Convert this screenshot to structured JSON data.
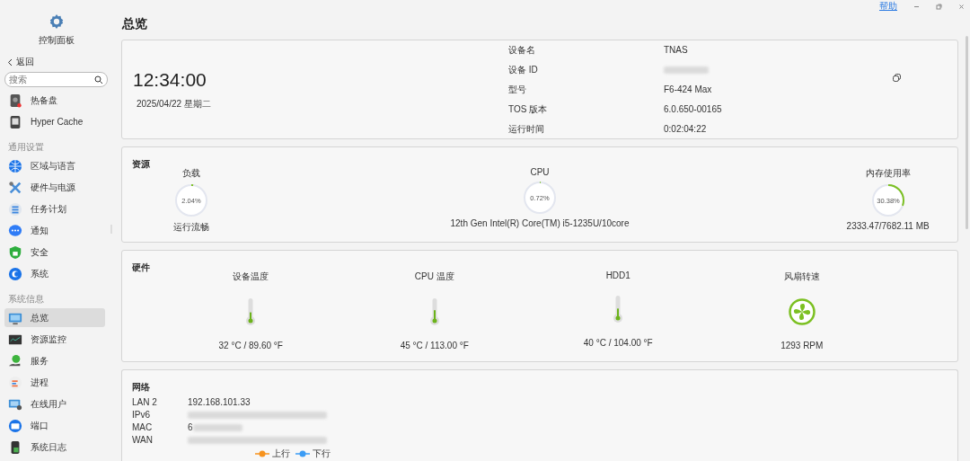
{
  "sidebar": {
    "title": "控制面板",
    "back": "返回",
    "search": {
      "placeholder": "搜索"
    },
    "groups": [
      {
        "items": [
          {
            "label": "热备盘",
            "selected": false
          },
          {
            "label": "Hyper Cache",
            "selected": false
          }
        ]
      },
      {
        "title": "通用设置",
        "items": [
          {
            "label": "区域与语言",
            "selected": false
          },
          {
            "label": "硬件与电源",
            "selected": false
          },
          {
            "label": "任务计划",
            "selected": false
          },
          {
            "label": "通知",
            "selected": false
          },
          {
            "label": "安全",
            "selected": false
          },
          {
            "label": "系统",
            "selected": false
          }
        ]
      },
      {
        "title": "系统信息",
        "items": [
          {
            "label": "总览",
            "selected": true
          },
          {
            "label": "资源监控",
            "selected": false
          },
          {
            "label": "服务",
            "selected": false
          },
          {
            "label": "进程",
            "selected": false
          },
          {
            "label": "在线用户",
            "selected": false
          },
          {
            "label": "端口",
            "selected": false
          },
          {
            "label": "系统日志",
            "selected": false
          }
        ]
      }
    ]
  },
  "window": {
    "help": "帮助"
  },
  "page_title": "总览",
  "overview": {
    "time": "12:34:00",
    "date": "2025/04/22 星期二",
    "fields": [
      {
        "label": "设备名",
        "value": "TNAS",
        "blurred": false
      },
      {
        "label": "设备 ID",
        "blurred": true
      },
      {
        "label": "型号",
        "value": "F6-424 Max",
        "blurred": false
      },
      {
        "label": "TOS 版本",
        "value": "6.0.650-00165",
        "blurred": false
      },
      {
        "label": "运行时间",
        "value": "0:02:04:22",
        "blurred": false
      }
    ]
  },
  "resources": {
    "title": "资源",
    "gauges": [
      {
        "label": "负载",
        "reading": "2.04%",
        "level": 0.0204,
        "caption": "运行流畅"
      },
      {
        "label": "CPU",
        "reading": "0.72%",
        "level": 0.0072,
        "caption": "12th Gen Intel(R) Core(TM) i5-1235U/10core"
      },
      {
        "label": "内存使用率",
        "reading": "30.38%",
        "level": 0.3038,
        "caption": "2333.47/7682.11 MB"
      }
    ]
  },
  "hardware": {
    "title": "硬件",
    "sensors": [
      {
        "kind": "thermometer",
        "label": "设备温度",
        "level": 0.35,
        "reading": "32 °C / 89.60 °F"
      },
      {
        "kind": "thermometer",
        "label": "CPU 温度",
        "level": 0.45,
        "reading": "45 °C / 113.00 °F"
      },
      {
        "kind": "thermometer",
        "label": "HDD1",
        "level": 0.4,
        "reading": "40 °C / 104.00 °F"
      },
      {
        "kind": "fan",
        "label": "风扇转速",
        "reading": "1293 RPM"
      }
    ]
  },
  "network": {
    "title": "网络",
    "rows": [
      {
        "label": "LAN 2",
        "value": "192.168.101.33",
        "blurred": false
      },
      {
        "label": "IPv6",
        "blurred": true
      },
      {
        "label": "MAC",
        "value": "6",
        "blurred": true
      },
      {
        "label": "WAN",
        "blurred": true
      }
    ],
    "legend": [
      {
        "label": "上行",
        "color": "#f7931e"
      },
      {
        "label": "下行",
        "color": "#3b9cf5"
      }
    ]
  }
}
